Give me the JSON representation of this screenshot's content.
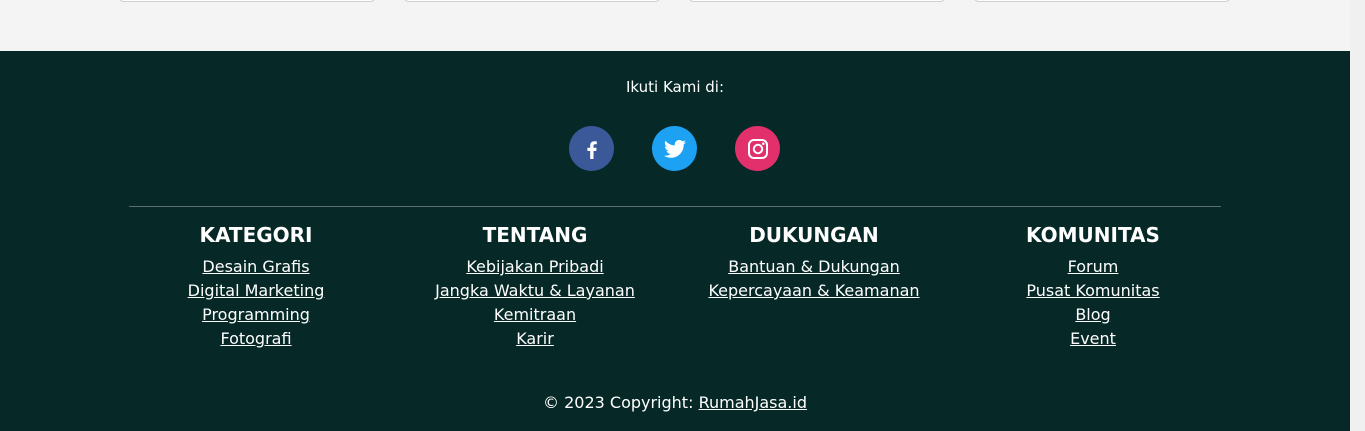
{
  "footer": {
    "follow_label": "Ikuti Kami di:",
    "social": [
      {
        "icon": "facebook-icon",
        "color": "#3b5998"
      },
      {
        "icon": "twitter-icon",
        "color": "#1da1f2"
      },
      {
        "icon": "instagram-icon",
        "color": "#e1306c"
      }
    ],
    "columns": [
      {
        "title": "KATEGORI",
        "links": [
          "Desain Grafis",
          "Digital Marketing",
          "Programming",
          "Fotografi"
        ]
      },
      {
        "title": "TENTANG",
        "links": [
          "Kebijakan Pribadi",
          "Jangka Waktu & Layanan",
          "Kemitraan",
          "Karir"
        ]
      },
      {
        "title": "DUKUNGAN",
        "links": [
          "Bantuan & Dukungan",
          "Kepercayaan & Keamanan"
        ]
      },
      {
        "title": "KOMUNITAS",
        "links": [
          "Forum",
          "Pusat Komunitas",
          "Blog",
          "Event"
        ]
      }
    ],
    "copyright_text": "© 2023 Copyright:",
    "copyright_link": "RumahJasa.id"
  },
  "colors": {
    "footer_bg": "#062826"
  }
}
